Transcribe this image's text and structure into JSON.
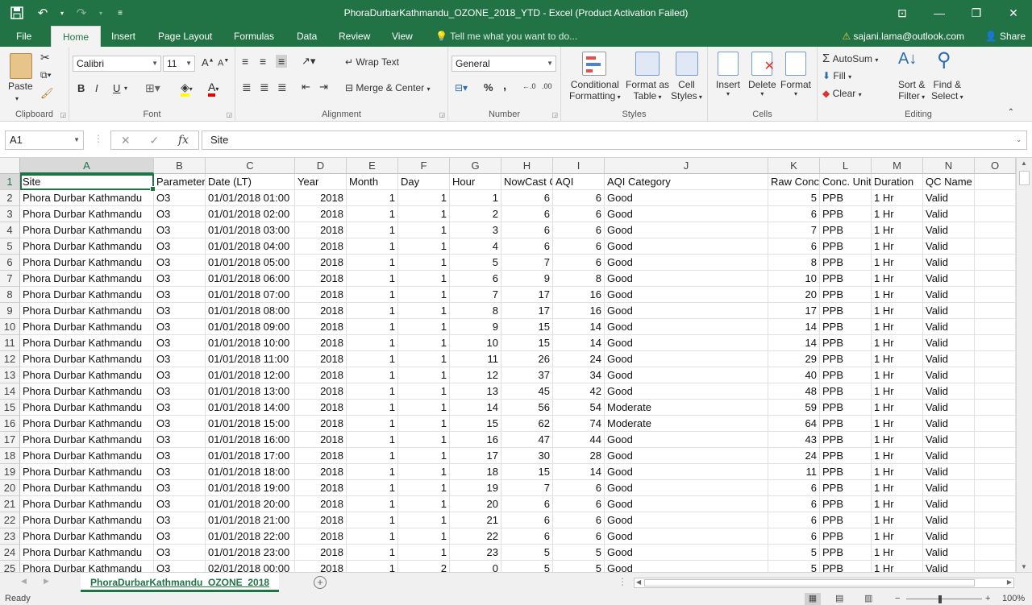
{
  "title": "PhoraDurbarKathmandu_OZONE_2018_YTD - Excel (Product Activation Failed)",
  "tabs": [
    "File",
    "Home",
    "Insert",
    "Page Layout",
    "Formulas",
    "Data",
    "Review",
    "View"
  ],
  "tell_me": "Tell me what you want to do...",
  "account": "sajani.lama@outlook.com",
  "share": "Share",
  "ribbon": {
    "clipboard": {
      "label": "Clipboard",
      "paste": "Paste"
    },
    "font": {
      "label": "Font",
      "name": "Calibri",
      "size": "11",
      "bold": "B",
      "italic": "I",
      "underline": "U"
    },
    "alignment": {
      "label": "Alignment",
      "wrap": "Wrap Text",
      "merge": "Merge & Center"
    },
    "number": {
      "label": "Number",
      "format": "General",
      "pct": "%",
      "comma": ","
    },
    "styles": {
      "label": "Styles",
      "cond1": "Conditional",
      "cond2": "Formatting",
      "fmt1": "Format as",
      "fmt2": "Table",
      "cell1": "Cell",
      "cell2": "Styles"
    },
    "cells": {
      "label": "Cells",
      "insert": "Insert",
      "delete": "Delete",
      "format": "Format"
    },
    "editing": {
      "label": "Editing",
      "autosum": "AutoSum",
      "fill": "Fill",
      "clear": "Clear",
      "sort1": "Sort &",
      "sort2": "Filter",
      "find1": "Find &",
      "find2": "Select"
    }
  },
  "formula_bar": {
    "name_box": "A1",
    "fx": "fx",
    "value": "Site"
  },
  "columns": [
    "A",
    "B",
    "C",
    "D",
    "E",
    "F",
    "G",
    "H",
    "I",
    "J",
    "K",
    "L",
    "M",
    "N",
    "O"
  ],
  "headers": [
    "Site",
    "Parameter",
    "Date (LT)",
    "Year",
    "Month",
    "Day",
    "Hour",
    "NowCast Conc.",
    "AQI",
    "AQI Category",
    "Raw Conc.",
    "Conc. Unit",
    "Duration",
    "QC Name"
  ],
  "rows": [
    [
      "Phora Durbar Kathmandu",
      "O3",
      "01/01/2018 01:00",
      "2018",
      "1",
      "1",
      "1",
      "6",
      "6",
      "Good",
      "5",
      "PPB",
      "1 Hr",
      "Valid"
    ],
    [
      "Phora Durbar Kathmandu",
      "O3",
      "01/01/2018 02:00",
      "2018",
      "1",
      "1",
      "2",
      "6",
      "6",
      "Good",
      "6",
      "PPB",
      "1 Hr",
      "Valid"
    ],
    [
      "Phora Durbar Kathmandu",
      "O3",
      "01/01/2018 03:00",
      "2018",
      "1",
      "1",
      "3",
      "6",
      "6",
      "Good",
      "7",
      "PPB",
      "1 Hr",
      "Valid"
    ],
    [
      "Phora Durbar Kathmandu",
      "O3",
      "01/01/2018 04:00",
      "2018",
      "1",
      "1",
      "4",
      "6",
      "6",
      "Good",
      "6",
      "PPB",
      "1 Hr",
      "Valid"
    ],
    [
      "Phora Durbar Kathmandu",
      "O3",
      "01/01/2018 05:00",
      "2018",
      "1",
      "1",
      "5",
      "7",
      "6",
      "Good",
      "8",
      "PPB",
      "1 Hr",
      "Valid"
    ],
    [
      "Phora Durbar Kathmandu",
      "O3",
      "01/01/2018 06:00",
      "2018",
      "1",
      "1",
      "6",
      "9",
      "8",
      "Good",
      "10",
      "PPB",
      "1 Hr",
      "Valid"
    ],
    [
      "Phora Durbar Kathmandu",
      "O3",
      "01/01/2018 07:00",
      "2018",
      "1",
      "1",
      "7",
      "17",
      "16",
      "Good",
      "20",
      "PPB",
      "1 Hr",
      "Valid"
    ],
    [
      "Phora Durbar Kathmandu",
      "O3",
      "01/01/2018 08:00",
      "2018",
      "1",
      "1",
      "8",
      "17",
      "16",
      "Good",
      "17",
      "PPB",
      "1 Hr",
      "Valid"
    ],
    [
      "Phora Durbar Kathmandu",
      "O3",
      "01/01/2018 09:00",
      "2018",
      "1",
      "1",
      "9",
      "15",
      "14",
      "Good",
      "14",
      "PPB",
      "1 Hr",
      "Valid"
    ],
    [
      "Phora Durbar Kathmandu",
      "O3",
      "01/01/2018 10:00",
      "2018",
      "1",
      "1",
      "10",
      "15",
      "14",
      "Good",
      "14",
      "PPB",
      "1 Hr",
      "Valid"
    ],
    [
      "Phora Durbar Kathmandu",
      "O3",
      "01/01/2018 11:00",
      "2018",
      "1",
      "1",
      "11",
      "26",
      "24",
      "Good",
      "29",
      "PPB",
      "1 Hr",
      "Valid"
    ],
    [
      "Phora Durbar Kathmandu",
      "O3",
      "01/01/2018 12:00",
      "2018",
      "1",
      "1",
      "12",
      "37",
      "34",
      "Good",
      "40",
      "PPB",
      "1 Hr",
      "Valid"
    ],
    [
      "Phora Durbar Kathmandu",
      "O3",
      "01/01/2018 13:00",
      "2018",
      "1",
      "1",
      "13",
      "45",
      "42",
      "Good",
      "48",
      "PPB",
      "1 Hr",
      "Valid"
    ],
    [
      "Phora Durbar Kathmandu",
      "O3",
      "01/01/2018 14:00",
      "2018",
      "1",
      "1",
      "14",
      "56",
      "54",
      "Moderate",
      "59",
      "PPB",
      "1 Hr",
      "Valid"
    ],
    [
      "Phora Durbar Kathmandu",
      "O3",
      "01/01/2018 15:00",
      "2018",
      "1",
      "1",
      "15",
      "62",
      "74",
      "Moderate",
      "64",
      "PPB",
      "1 Hr",
      "Valid"
    ],
    [
      "Phora Durbar Kathmandu",
      "O3",
      "01/01/2018 16:00",
      "2018",
      "1",
      "1",
      "16",
      "47",
      "44",
      "Good",
      "43",
      "PPB",
      "1 Hr",
      "Valid"
    ],
    [
      "Phora Durbar Kathmandu",
      "O3",
      "01/01/2018 17:00",
      "2018",
      "1",
      "1",
      "17",
      "30",
      "28",
      "Good",
      "24",
      "PPB",
      "1 Hr",
      "Valid"
    ],
    [
      "Phora Durbar Kathmandu",
      "O3",
      "01/01/2018 18:00",
      "2018",
      "1",
      "1",
      "18",
      "15",
      "14",
      "Good",
      "11",
      "PPB",
      "1 Hr",
      "Valid"
    ],
    [
      "Phora Durbar Kathmandu",
      "O3",
      "01/01/2018 19:00",
      "2018",
      "1",
      "1",
      "19",
      "7",
      "6",
      "Good",
      "6",
      "PPB",
      "1 Hr",
      "Valid"
    ],
    [
      "Phora Durbar Kathmandu",
      "O3",
      "01/01/2018 20:00",
      "2018",
      "1",
      "1",
      "20",
      "6",
      "6",
      "Good",
      "6",
      "PPB",
      "1 Hr",
      "Valid"
    ],
    [
      "Phora Durbar Kathmandu",
      "O3",
      "01/01/2018 21:00",
      "2018",
      "1",
      "1",
      "21",
      "6",
      "6",
      "Good",
      "6",
      "PPB",
      "1 Hr",
      "Valid"
    ],
    [
      "Phora Durbar Kathmandu",
      "O3",
      "01/01/2018 22:00",
      "2018",
      "1",
      "1",
      "22",
      "6",
      "6",
      "Good",
      "6",
      "PPB",
      "1 Hr",
      "Valid"
    ],
    [
      "Phora Durbar Kathmandu",
      "O3",
      "01/01/2018 23:00",
      "2018",
      "1",
      "1",
      "23",
      "5",
      "5",
      "Good",
      "5",
      "PPB",
      "1 Hr",
      "Valid"
    ],
    [
      "Phora Durbar Kathmandu",
      "O3",
      "02/01/2018 00:00",
      "2018",
      "1",
      "2",
      "0",
      "5",
      "5",
      "Good",
      "5",
      "PPB",
      "1 Hr",
      "Valid"
    ]
  ],
  "sheet_tab": "PhoraDurbarKathmandu_OZONE_2018",
  "status": "Ready",
  "zoom": "100%",
  "accent_color": "#217346"
}
